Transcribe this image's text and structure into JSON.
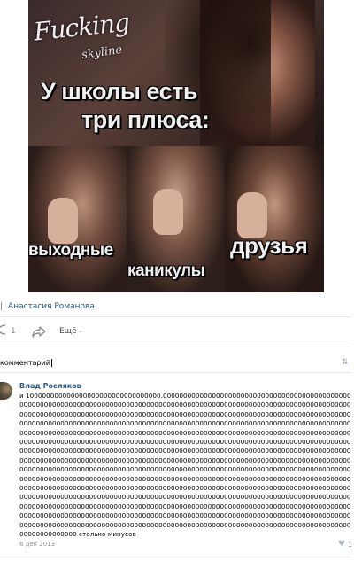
{
  "post_image": {
    "logo": "Fucking",
    "logo_sub": "skyline",
    "caption_line1": "У школы есть",
    "caption_line2": "три плюса:",
    "word1": "выходные",
    "word2": "каникулы",
    "word3": "друзья"
  },
  "author": {
    "name": "Анастасия Романова"
  },
  "actions": {
    "likes": "1",
    "more_label": "Ещё"
  },
  "comment_input": {
    "value": "комментарий"
  },
  "comment": {
    "author": "Влад Росляков",
    "text": "и 100000000000000000000000000000000.000000000000000000000000000000000000000000000000000000000000000000000000000000000000000000000000000000000000000000000000000000000000000000000000000000000000000000000000000000000000000000000000000000000000000000000000000000000000000000000000000000000000000000000000000000000000000000000000000000000000000000000000000000000000000000000000000000000000000000000000000000000000000000000000000000000000000000000000000000000000000000000000000000000000000000000000000000000000000000000000000000000000000000000000000000000000000000000000000000000000000000000000000000000000000000000000000000000000000000000000000000000000000000000000000000000000000000000000000000000000000000000000000000000000000000000000000000000000000000000000000000000000000000000000000000000000000000000000000000000000000000000000000000000000000000000000000000000000000000000000000000000000000000000000000000000000000000000000000000000000000000000000000000000000000000000000000000000000000000000000000000000000000000000000000000000000000000000000000000000000000000000000000000000000000000000000000000000000000000000000000000000000000000000000000000000000000000000000000000000000000000000000000000000000000000000000000000000000000000 столько минусов",
    "date": "6 дек 2013",
    "likes": "1"
  },
  "colors": {
    "link": "#2a5885",
    "muted": "#828282",
    "separator": "#e7e8ec"
  }
}
